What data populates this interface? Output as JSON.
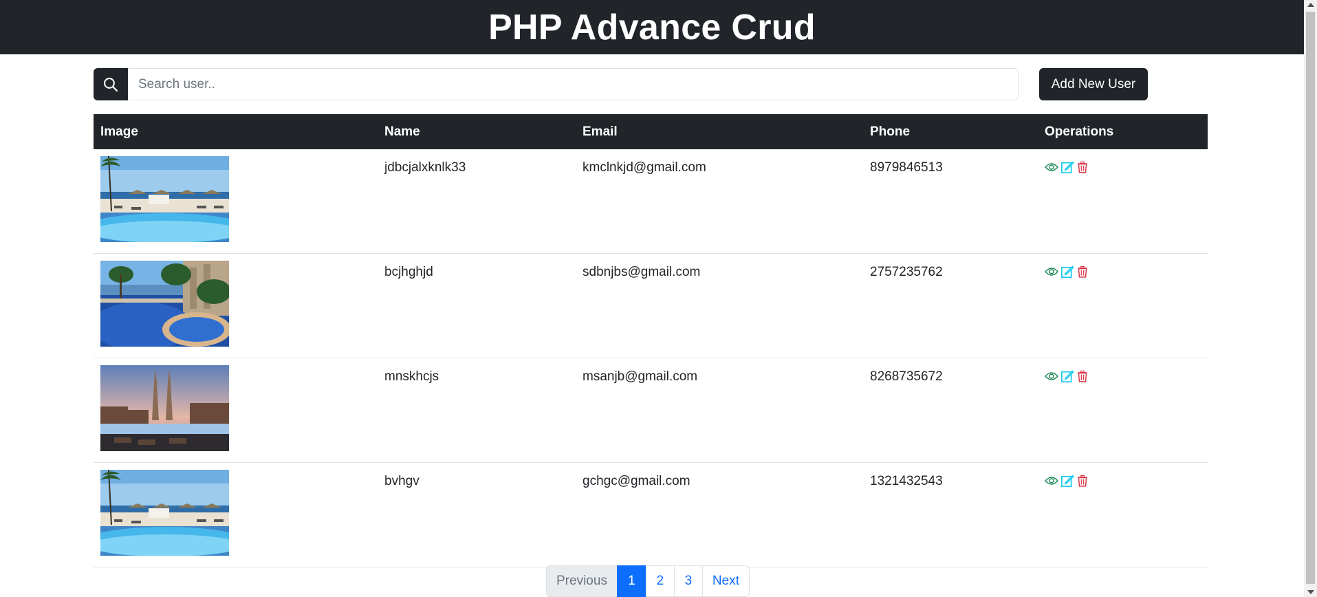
{
  "header": {
    "title": "PHP Advance Crud"
  },
  "search": {
    "placeholder": "Search user..",
    "value": ""
  },
  "toolbar": {
    "add_label": "Add New User"
  },
  "table": {
    "columns": [
      "Image",
      "Name",
      "Email",
      "Phone",
      "Operations"
    ],
    "rows": [
      {
        "image": "pool-resort-photo",
        "name": "jdbcjalxknlk33",
        "email": "kmclnkjd@gmail.com",
        "phone": "8979846513"
      },
      {
        "image": "pool-palms-photo",
        "name": "bcjhghjd",
        "email": "sdbnjbs@gmail.com",
        "phone": "2757235762"
      },
      {
        "image": "city-towers-photo",
        "name": "mnskhcjs",
        "email": "msanjb@gmail.com",
        "phone": "8268735672"
      },
      {
        "image": "pool-resort-photo",
        "name": "bvhgv",
        "email": "gchgc@gmail.com",
        "phone": "1321432543"
      }
    ]
  },
  "pagination": {
    "previous": "Previous",
    "pages": [
      "1",
      "2",
      "3"
    ],
    "active_page": "1",
    "next": "Next"
  },
  "colors": {
    "dark": "#212529",
    "view": "#198754",
    "edit": "#0dcaf0",
    "delete": "#dc3545",
    "primary": "#0d6efd"
  }
}
